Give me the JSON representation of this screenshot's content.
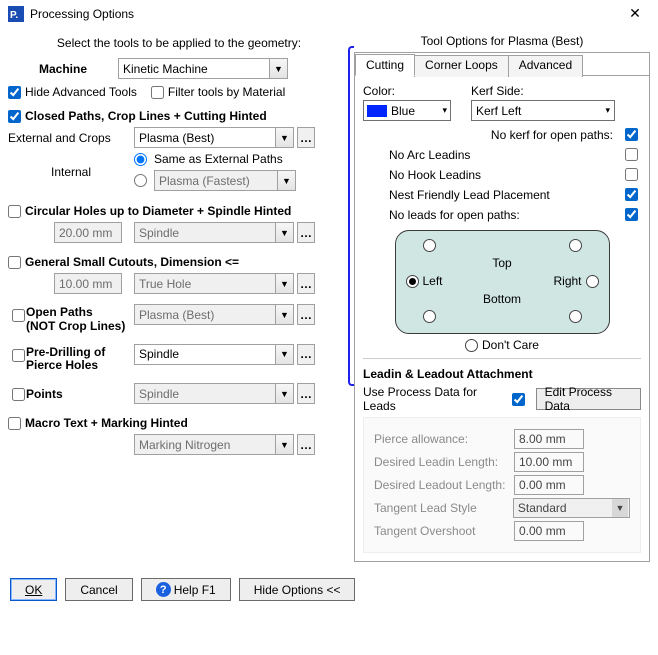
{
  "window": {
    "title": "Processing Options",
    "icon_letter": "P."
  },
  "left": {
    "subtitle": "Select the tools to be applied to the geometry:",
    "machine_label": "Machine",
    "machine_value": "Kinetic Machine",
    "hide_adv_tools": "Hide Advanced Tools",
    "filter_by_material": "Filter tools by Material",
    "closed_paths": {
      "label": "Closed Paths,  Crop Lines  +  Cutting Hinted",
      "ext_label": "External and Crops",
      "ext_tool": "Plasma (Best)",
      "internal_label": "Internal",
      "same_as_ext": "Same as External Paths",
      "internal_tool": "Plasma (Fastest)"
    },
    "circ_holes": {
      "label": "Circular Holes up to Diameter   +  Spindle Hinted",
      "value": "20.00 mm",
      "tool": "Spindle"
    },
    "small_cut": {
      "label": "General Small Cutouts, Dimension <=",
      "value": "10.00 mm",
      "tool": "True Hole"
    },
    "open_paths": {
      "label1": "Open Paths",
      "label2": "(NOT Crop Lines)",
      "tool": "Plasma (Best)"
    },
    "predrill": {
      "label1": "Pre-Drilling of",
      "label2": "Pierce Holes",
      "tool": "Spindle"
    },
    "points": {
      "label": "Points",
      "tool": "Spindle"
    },
    "macro": {
      "label": "Macro Text   +  Marking Hinted",
      "tool": "Marking Nitrogen"
    }
  },
  "right": {
    "header": "Tool Options for Plasma (Best)",
    "tabs": {
      "cutting": "Cutting",
      "corner": "Corner Loops",
      "advanced": "Advanced"
    },
    "color_label": "Color:",
    "color_value": "Blue",
    "kerf_label": "Kerf Side:",
    "kerf_value": "Kerf Left",
    "no_kerf_open": "No kerf for open paths:",
    "no_arc": "No Arc Leadins",
    "no_hook": "No Hook Leadins",
    "nest_friendly": "Nest Friendly Lead Placement",
    "no_leads_open": "No leads for open paths:",
    "leadpos": {
      "top": "Top",
      "bottom": "Bottom",
      "left": "Left",
      "right": "Right",
      "dontcare": "Don't Care"
    },
    "leadin_hdr": "Leadin & Leadout Attachment",
    "use_proc": "Use Process Data for Leads",
    "edit_proc": "Edit Process Data",
    "params": {
      "pierce_lbl": "Pierce allowance:",
      "pierce_val": "8.00 mm",
      "leadin_lbl": "Desired Leadin Length:",
      "leadin_val": "10.00 mm",
      "leadout_lbl": "Desired Leadout Length:",
      "leadout_val": "0.00 mm",
      "tls_lbl": "Tangent Lead Style",
      "tls_val": "Standard",
      "tos_lbl": "Tangent Overshoot",
      "tos_val": "0.00 mm"
    }
  },
  "footer": {
    "ok": "OK",
    "cancel": "Cancel",
    "help": "Help F1",
    "hide": "Hide Options <<"
  }
}
